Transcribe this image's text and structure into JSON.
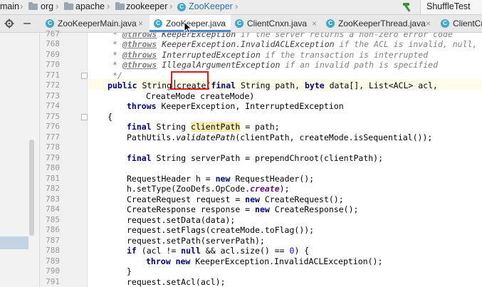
{
  "breadcrumb": {
    "items": [
      "main",
      "org",
      "apache",
      "zookeeper"
    ],
    "current": "ZooKeeper",
    "current_icon": "C"
  },
  "run_config": {
    "label": "ShuffleTest"
  },
  "tabs": [
    {
      "label": "ZooKeeperMain.java",
      "icon": "C"
    },
    {
      "label": "ZooKeeper.java",
      "icon": "C",
      "active": true
    },
    {
      "label": "ClientCnxn.java",
      "icon": "C"
    },
    {
      "label": "ZooKeeperThread.java",
      "icon": "C"
    },
    {
      "label": "ClientCn",
      "icon": "C"
    }
  ],
  "tab_close_glyph": "×",
  "gutter": {
    "line_numbers": [
      "767",
      "768",
      "769",
      "770",
      "771",
      "772",
      "773",
      "774",
      "775",
      "776",
      "777",
      "778",
      "779",
      "780",
      "781",
      "782",
      "783",
      "784",
      "785",
      "786",
      "787",
      "788",
      "789",
      "790",
      "791"
    ]
  },
  "code": {
    "l767_tag": "@throws",
    "l767_ref": "KeeperException",
    "l767_text": " if the server returns a non-zero error code",
    "l768_tag": "@throws",
    "l768_ref": "KeeperException.InvalidACLException",
    "l768_text": " if the ACL is invalid, null, or",
    "l769_tag": "@throws",
    "l769_ref": "InterruptedException",
    "l769_text": " if the transaction is interrupted",
    "l770_tag": "@throws",
    "l770_ref": "IllegalArgumentException",
    "l770_text": " if an invalid path is specified",
    "l771_text": "*/",
    "l772_public": "public",
    "l772_a": " String ",
    "l772_method": "create",
    "l772_b": "(",
    "l772_final": "final",
    "l772_c": " String path, ",
    "l772_byte": "byte",
    "l772_d": " data[], List<ACL> acl,",
    "l773_text": "CreateMode createMode)",
    "l774_throws": "throws",
    "l774_text": " KeeperException, InterruptedException",
    "l775_text": "{",
    "l777_final": "final",
    "l777_a": " String ",
    "l777_var": "clientPath",
    "l777_b": " = path;",
    "l778_a": "PathUtils.",
    "l778_method": "validatePath",
    "l778_b": "(clientPath, createMode.isSequential());",
    "l780_final": "final",
    "l780_text": " String serverPath = prependChroot(clientPath);",
    "l782_a": "RequestHeader h = ",
    "l782_new": "new",
    "l782_b": " RequestHeader();",
    "l783_a": "h.setType(ZooDefs.OpCode.",
    "l783_field": "create",
    "l783_b": ");",
    "l784_a": "CreateRequest request = ",
    "l784_new": "new",
    "l784_b": " CreateRequest();",
    "l785_a": "CreateResponse response = ",
    "l785_new": "new",
    "l785_b": " CreateResponse();",
    "l786_text": "request.setData(data);",
    "l787_text": "request.setFlags(createMode.toFlag());",
    "l788_text": "request.setPath(serverPath);",
    "l789_if": "if",
    "l789_a": " (acl != ",
    "l789_null": "null",
    "l789_b": " && acl.size() == ",
    "l789_num": "0",
    "l789_c": ") {",
    "l790_throw": "throw",
    "l790_new": "new",
    "l790_text": " KeeperException.InvalidACLException();",
    "l791_text": "}",
    "l792_text": "request.setAcl(acl);"
  }
}
